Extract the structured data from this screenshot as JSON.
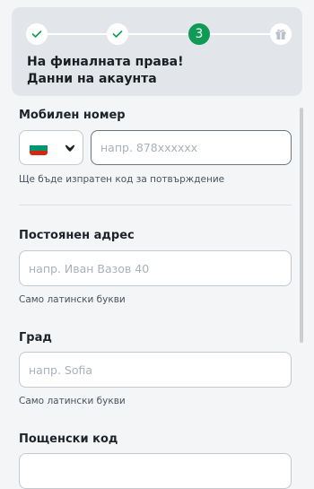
{
  "stepper": {
    "steps": [
      {
        "state": "done",
        "icon": "check-icon"
      },
      {
        "state": "done",
        "icon": "check-icon"
      },
      {
        "state": "active",
        "number": "3"
      },
      {
        "state": "upcoming",
        "icon": "gift-icon"
      }
    ],
    "colors": {
      "active": "#0f9a55",
      "check": "#0f9a55",
      "gift": "#b9c0c7"
    }
  },
  "header": {
    "title_line1": "На финалната права!",
    "title_line2": "Данни на акаунта"
  },
  "form": {
    "phone": {
      "label": "Мобилен номер",
      "country_flag": "bulgaria-flag",
      "placeholder": "напр. 878xxxxxx",
      "helper": "Ще бъде изпратен код за потвърждение"
    },
    "address": {
      "label": "Постоянен адрес",
      "placeholder": "напр. Иван Вазов 40",
      "helper": "Само латински букви"
    },
    "city": {
      "label": "Град",
      "placeholder": "напр. Sofia",
      "helper": "Само латински букви"
    },
    "postal": {
      "label": "Пощенски код"
    }
  }
}
